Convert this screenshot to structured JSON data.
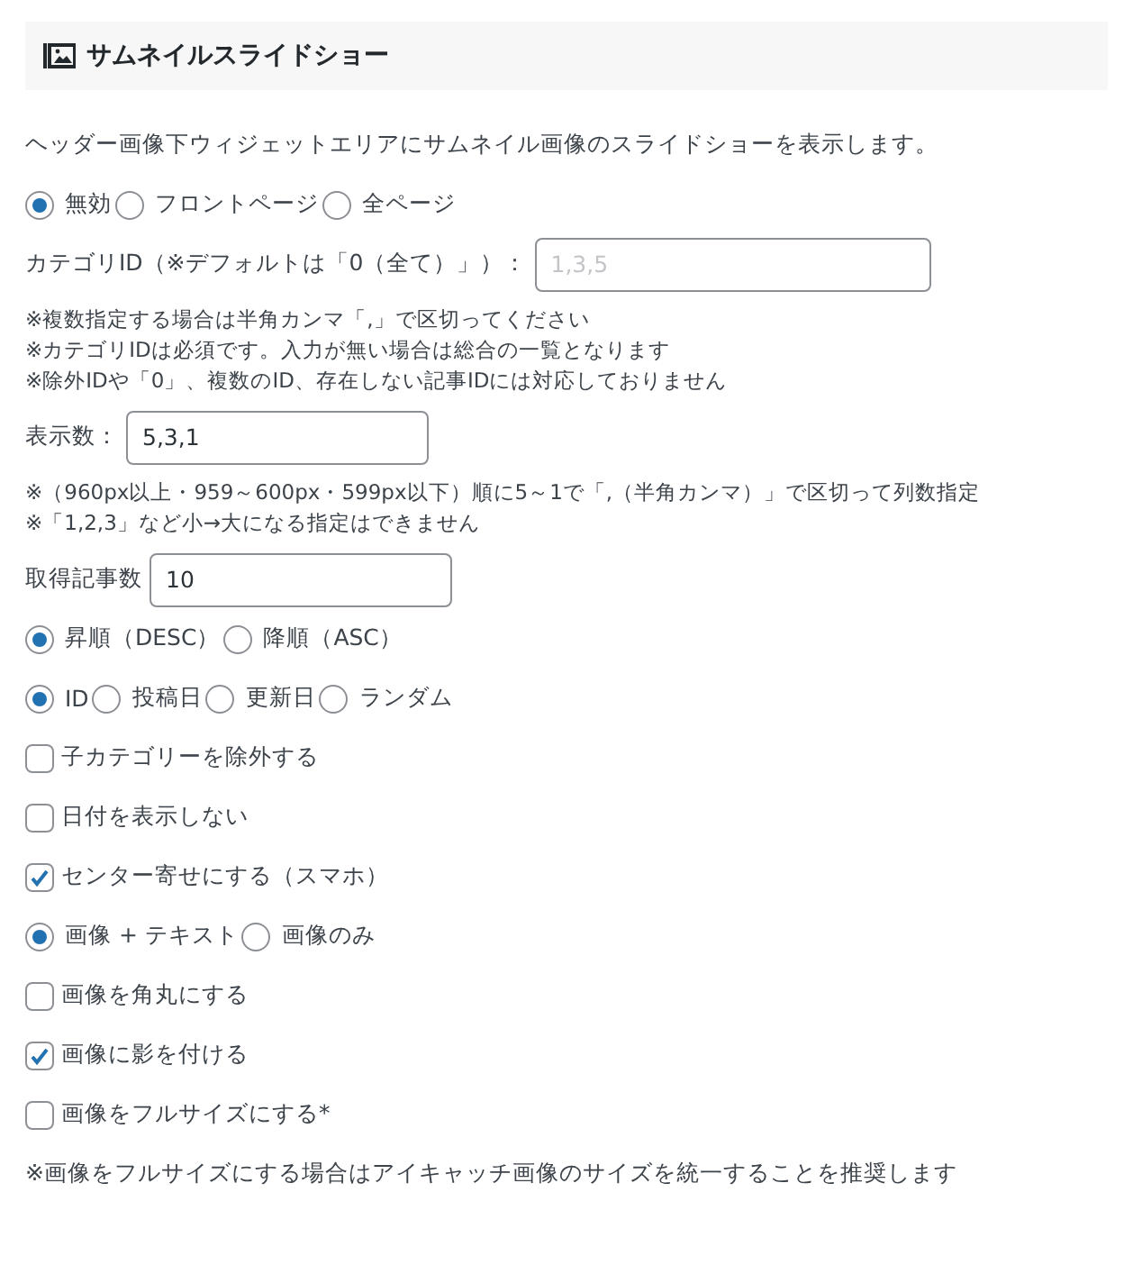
{
  "header": {
    "title": "サムネイルスライドショー"
  },
  "rows": [
    {
      "kind": "text",
      "text": "ヘッダー画像下ウィジェットエリアにサムネイル画像のスライドショーを表示します。"
    },
    {
      "kind": "radios",
      "options": [
        {
          "label": "無効",
          "selected": true
        },
        {
          "label": "フロントページ",
          "selected": false
        },
        {
          "label": "全ページ",
          "selected": false
        }
      ]
    },
    {
      "kind": "input",
      "label": "カテゴリID（※デフォルトは「0（全て）」）：",
      "placeholder": "1,3,5",
      "wide": true
    },
    {
      "kind": "notes",
      "lines": [
        "※複数指定する場合は半角カンマ「,」で区切ってください",
        "※カテゴリIDは必須です。入力が無い場合は総合の一覧となります",
        "※除外IDや「0」、複数のID、存在しない記事IDには対応しておりません"
      ]
    },
    {
      "kind": "input",
      "label": "表示数：",
      "value": "5,3,1"
    },
    {
      "kind": "notes",
      "lines": [
        "※（960px以上・959～600px・599px以下）順に5～1で「,（半角カンマ）」で区切って列数指定",
        "※「1,2,3」など小→大になる指定はできません"
      ]
    },
    {
      "kind": "input",
      "label": "取得記事数",
      "value": "10"
    },
    {
      "kind": "radios",
      "options": [
        {
          "label": "昇順（DESC）",
          "selected": true
        },
        {
          "label": "降順（ASC）",
          "selected": false
        }
      ]
    },
    {
      "kind": "radios",
      "options": [
        {
          "label": "ID",
          "selected": true
        },
        {
          "label": "投稿日",
          "selected": false
        },
        {
          "label": "更新日",
          "selected": false
        },
        {
          "label": "ランダム",
          "selected": false
        }
      ]
    },
    {
      "kind": "checkbox",
      "label": "子カテゴリーを除外する",
      "checked": false
    },
    {
      "kind": "checkbox",
      "label": "日付を表示しない",
      "checked": false
    },
    {
      "kind": "checkbox",
      "label": "センター寄せにする（スマホ）",
      "checked": true
    },
    {
      "kind": "radios",
      "options": [
        {
          "label": "画像 + テキスト",
          "selected": true
        },
        {
          "label": "画像のみ",
          "selected": false
        }
      ]
    },
    {
      "kind": "checkbox",
      "label": "画像を角丸にする",
      "checked": false
    },
    {
      "kind": "checkbox",
      "label": "画像に影を付ける",
      "checked": true
    },
    {
      "kind": "checkbox",
      "label": "画像をフルサイズにする*",
      "checked": false
    },
    {
      "kind": "text",
      "text": "※画像をフルサイズにする場合はアイキャッチ画像のサイズを統一することを推奨します"
    }
  ]
}
